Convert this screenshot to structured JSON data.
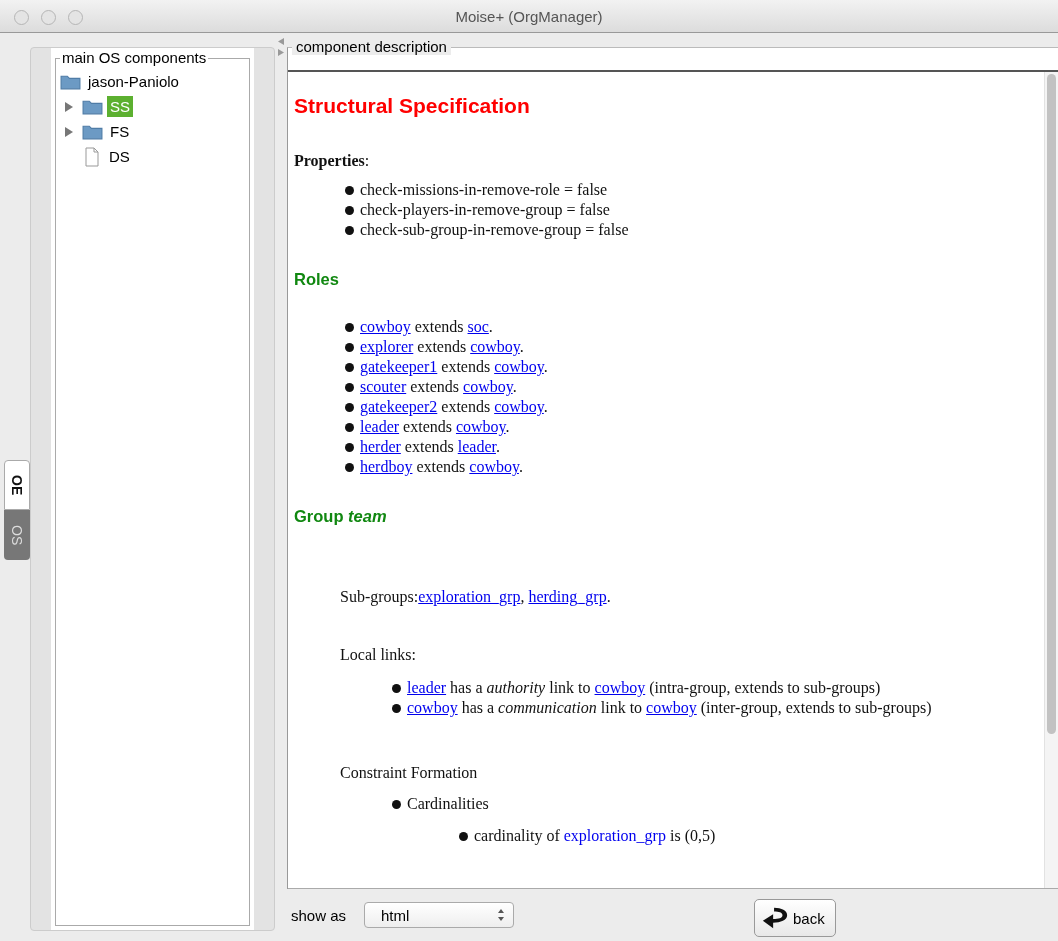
{
  "window": {
    "title": "Moise+ (OrgManager)"
  },
  "side_tabs": [
    {
      "label": "OE",
      "selected": true
    },
    {
      "label": "OS",
      "selected": false
    }
  ],
  "tree": {
    "title": "main OS components",
    "root": {
      "label": "jason-Paniolo",
      "kind": "folder",
      "children": [
        {
          "label": "SS",
          "kind": "folder",
          "expanded": false,
          "selected": true
        },
        {
          "label": "FS",
          "kind": "folder",
          "expanded": false,
          "selected": false
        },
        {
          "label": "DS",
          "kind": "file",
          "selected": false
        }
      ]
    }
  },
  "description": {
    "title": "component description",
    "heading": "Structural Specification",
    "properties_label": "**Properties**:",
    "properties": [
      "check-missions-in-remove-role = false",
      "check-players-in-remove-group = false",
      "check-sub-group-in-remove-group = false"
    ],
    "roles_heading": "Roles",
    "roles": [
      [
        {
          "kind": "link",
          "text": "cowboy"
        },
        {
          "kind": "text",
          "text": " extends "
        },
        {
          "kind": "link",
          "text": "soc"
        },
        {
          "kind": "text",
          "text": "."
        }
      ],
      [
        {
          "kind": "link",
          "text": "explorer"
        },
        {
          "kind": "text",
          "text": " extends "
        },
        {
          "kind": "link",
          "text": "cowboy"
        },
        {
          "kind": "text",
          "text": "."
        }
      ],
      [
        {
          "kind": "link",
          "text": "gatekeeper1"
        },
        {
          "kind": "text",
          "text": " extends "
        },
        {
          "kind": "link",
          "text": "cowboy"
        },
        {
          "kind": "text",
          "text": "."
        }
      ],
      [
        {
          "kind": "link",
          "text": "scouter"
        },
        {
          "kind": "text",
          "text": " extends "
        },
        {
          "kind": "link",
          "text": "cowboy"
        },
        {
          "kind": "text",
          "text": "."
        }
      ],
      [
        {
          "kind": "link",
          "text": "gatekeeper2"
        },
        {
          "kind": "text",
          "text": " extends "
        },
        {
          "kind": "link",
          "text": "cowboy"
        },
        {
          "kind": "text",
          "text": "."
        }
      ],
      [
        {
          "kind": "link",
          "text": "leader"
        },
        {
          "kind": "text",
          "text": " extends "
        },
        {
          "kind": "link",
          "text": "cowboy"
        },
        {
          "kind": "text",
          "text": "."
        }
      ],
      [
        {
          "kind": "link",
          "text": "herder"
        },
        {
          "kind": "text",
          "text": " extends "
        },
        {
          "kind": "link",
          "text": "leader"
        },
        {
          "kind": "text",
          "text": "."
        }
      ],
      [
        {
          "kind": "link",
          "text": "herdboy"
        },
        {
          "kind": "text",
          "text": " extends "
        },
        {
          "kind": "link",
          "text": "cowboy"
        },
        {
          "kind": "text",
          "text": "."
        }
      ]
    ],
    "group_heading": "Group *team*",
    "subgroups": [
      {
        "kind": "text",
        "text": "Sub-groups:"
      },
      {
        "kind": "link",
        "text": "exploration_grp"
      },
      {
        "kind": "text",
        "text": ", "
      },
      {
        "kind": "link",
        "text": "herding_grp"
      },
      {
        "kind": "text",
        "text": "."
      }
    ],
    "local_links_label": "Local links:",
    "local_links": [
      [
        {
          "kind": "link",
          "text": "leader"
        },
        {
          "kind": "text",
          "text": " has a *authority* link to "
        },
        {
          "kind": "link",
          "text": "cowboy"
        },
        {
          "kind": "text",
          "text": " (intra-group, extends to sub-groups)"
        }
      ],
      [
        {
          "kind": "link",
          "text": "cowboy"
        },
        {
          "kind": "text",
          "text": " has a *communication* link to "
        },
        {
          "kind": "link",
          "text": "cowboy"
        },
        {
          "kind": "text",
          "text": " (inter-group, extends to sub-groups)"
        }
      ]
    ],
    "constraint_label": "Constraint Formation",
    "cardinalities_label": "Cardinalities",
    "cardinalities": [
      [
        {
          "kind": "text",
          "text": "cardinality of "
        },
        {
          "kind": "link",
          "text": "exploration_grp"
        },
        {
          "kind": "text",
          "text": " is (0,5)"
        }
      ]
    ]
  },
  "footer": {
    "show_as_label": "show as",
    "format": "html",
    "back_button": "back"
  }
}
